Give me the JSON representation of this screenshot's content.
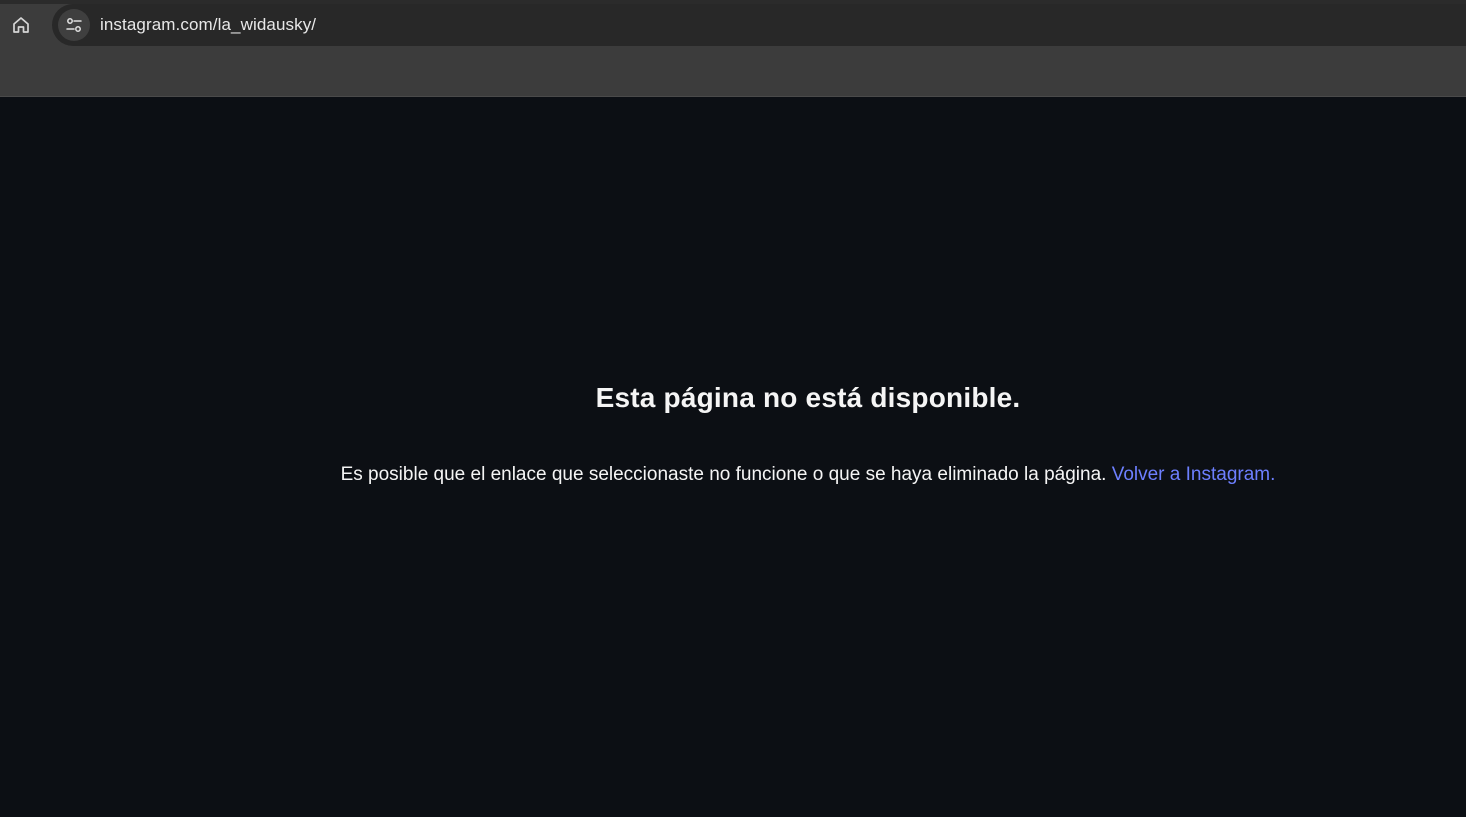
{
  "browser": {
    "url": "instagram.com/la_widausky/",
    "home_icon": "home-icon",
    "site_info_icon": "tune-icon"
  },
  "page": {
    "title": "Esta página no está disponible.",
    "message": "Es posible que el enlace que seleccionaste no funcione o que se haya eliminado la página.",
    "link_label": "Volver a Instagram."
  },
  "colors": {
    "background": "#0c0f14",
    "chrome": "#3c3c3c",
    "omnibox": "#282828",
    "link": "#6d7fff",
    "text": "#f5f5f5"
  }
}
